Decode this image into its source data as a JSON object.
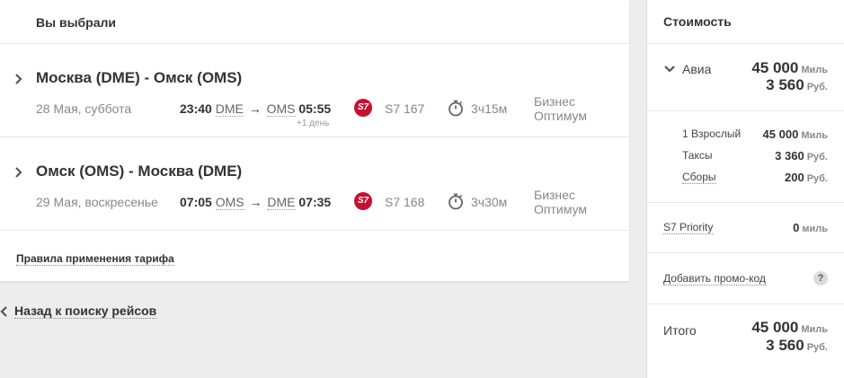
{
  "summary": {
    "title": "Вы выбрали",
    "flights": [
      {
        "route": "Москва (DME) - Омск (OMS)",
        "date": "28 Мая, суббота",
        "dep_time": "23:40",
        "dep_airport": "DME",
        "arr_airport": "OMS",
        "arr_time": "05:55",
        "next_day": "+1 день",
        "airline_logo": "S7",
        "flight_number": "S7 167",
        "duration": "3ч15м",
        "fare_class_1": "Бизнес",
        "fare_class_2": "Оптимум"
      },
      {
        "route": "Омск (OMS) - Москва (DME)",
        "date": "29 Мая, воскресенье",
        "dep_time": "07:05",
        "dep_airport": "OMS",
        "arr_airport": "DME",
        "arr_time": "07:35",
        "next_day": "",
        "airline_logo": "S7",
        "flight_number": "S7 168",
        "duration": "3ч30м",
        "fare_class_1": "Бизнес",
        "fare_class_2": "Оптимум"
      }
    ],
    "fare_rules_link": "Правила применения тарифа",
    "back_link": "Назад к поиску рейсов",
    "arrow": "→"
  },
  "cost": {
    "title": "Стоимость",
    "avia_label": "Авиа",
    "avia_miles": "45 000",
    "avia_miles_unit": "Миль",
    "avia_rub": "3 560",
    "avia_rub_unit": "Руб.",
    "rows": [
      {
        "label": "1 Взрослый",
        "value": "45 000",
        "unit": "Миль"
      },
      {
        "label": "Таксы",
        "value": "3 360",
        "unit": "Руб."
      },
      {
        "label": "Сборы",
        "value": "200",
        "unit": "Руб."
      }
    ],
    "priority_label": "S7 Priority",
    "priority_value": "0",
    "priority_unit": "миль",
    "promo_label": "Добавить промо-код",
    "promo_help": "?",
    "total_label": "Итого",
    "total_miles": "45 000",
    "total_miles_unit": "Миль",
    "total_rub": "3 560",
    "total_rub_unit": "Руб."
  },
  "colors": {
    "brand_red": "#c8102e",
    "background": "#ededed"
  }
}
